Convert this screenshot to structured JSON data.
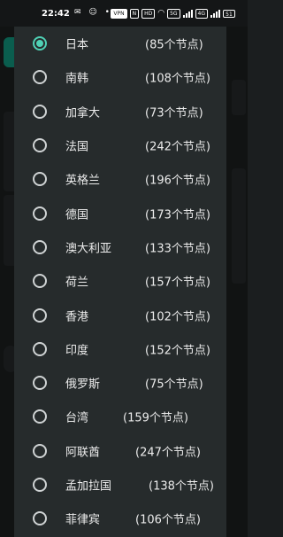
{
  "status_bar": {
    "time": "22:42",
    "left_icons": "✉ ☺ •",
    "tags": [
      "VPN",
      "N",
      "HD",
      "5G",
      "4G"
    ],
    "battery": "51"
  },
  "dialog": {
    "options": [
      {
        "name": "日本",
        "count": "(85个节点)",
        "selected": true
      },
      {
        "name": "南韩",
        "count": "(108个节点)",
        "selected": false
      },
      {
        "name": "加拿大",
        "count": "(73个节点)",
        "selected": false
      },
      {
        "name": "法国",
        "count": "(242个节点)",
        "selected": false
      },
      {
        "name": "英格兰",
        "count": "(196个节点)",
        "selected": false
      },
      {
        "name": "德国",
        "count": "(173个节点)",
        "selected": false
      },
      {
        "name": "澳大利亚",
        "count": "(133个节点)",
        "selected": false
      },
      {
        "name": "荷兰",
        "count": "(157个节点)",
        "selected": false
      },
      {
        "name": "香港",
        "count": "(102个节点)",
        "selected": false
      },
      {
        "name": "印度",
        "count": "(152个节点)",
        "selected": false
      },
      {
        "name": "俄罗斯",
        "count": "(75个节点)",
        "selected": false
      },
      {
        "name": "台湾",
        "count": "(159个节点)",
        "selected": false
      },
      {
        "name": "阿联酋",
        "count": "(247个节点)",
        "selected": false
      },
      {
        "name": "孟加拉国",
        "count": "(138个节点)",
        "selected": false
      },
      {
        "name": "菲律宾",
        "count": "(106个节点)",
        "selected": false
      }
    ]
  },
  "colors": {
    "accent": "#4fd1b5",
    "dialog_background": "#262b2c"
  }
}
